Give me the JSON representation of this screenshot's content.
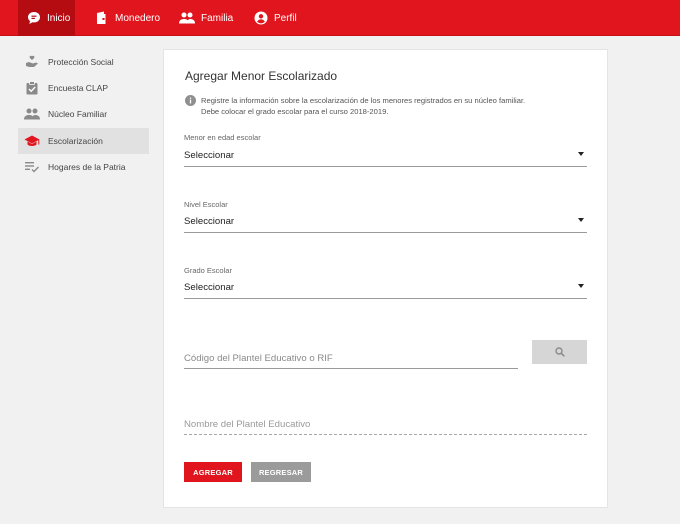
{
  "nav": {
    "items": [
      {
        "label": "Inicio",
        "icon": "chat-bubble-icon"
      },
      {
        "label": "Monedero",
        "icon": "wallet-icon"
      },
      {
        "label": "Familia",
        "icon": "people-icon"
      },
      {
        "label": "Perfil",
        "icon": "account-circle-icon"
      }
    ]
  },
  "sidebar": {
    "items": [
      {
        "label": "Protección Social",
        "icon": "hand-heart-icon"
      },
      {
        "label": "Encuesta CLAP",
        "icon": "clipboard-check-icon"
      },
      {
        "label": "Núcleo Familiar",
        "icon": "people-icon"
      },
      {
        "label": "Escolarización",
        "icon": "graduation-cap-icon"
      },
      {
        "label": "Hogares de la Patria",
        "icon": "checklist-icon"
      }
    ]
  },
  "form": {
    "title": "Agregar Menor Escolarizado",
    "info_line1": "Registre la información sobre la escolarización de los menores registrados en su núcleo familiar.",
    "info_line2": "Debe colocar el grado escolar para el curso 2018-2019.",
    "minor": {
      "label": "Menor en edad escolar",
      "value": "Seleccionar"
    },
    "level": {
      "label": "Nivel Escolar",
      "value": "Seleccionar"
    },
    "grade": {
      "label": "Grado Escolar",
      "value": "Seleccionar"
    },
    "code": {
      "placeholder": "Código del Plantel Educativo o RIF"
    },
    "school_name": {
      "placeholder": "Nombre del Plantel Educativo"
    },
    "add_label": "AGREGAR",
    "back_label": "REGRESAR"
  },
  "colors": {
    "brand": "#e0151d",
    "brand_dark": "#b50c12",
    "background": "#f1f1f1",
    "secondary_button": "#9b9b9b"
  }
}
